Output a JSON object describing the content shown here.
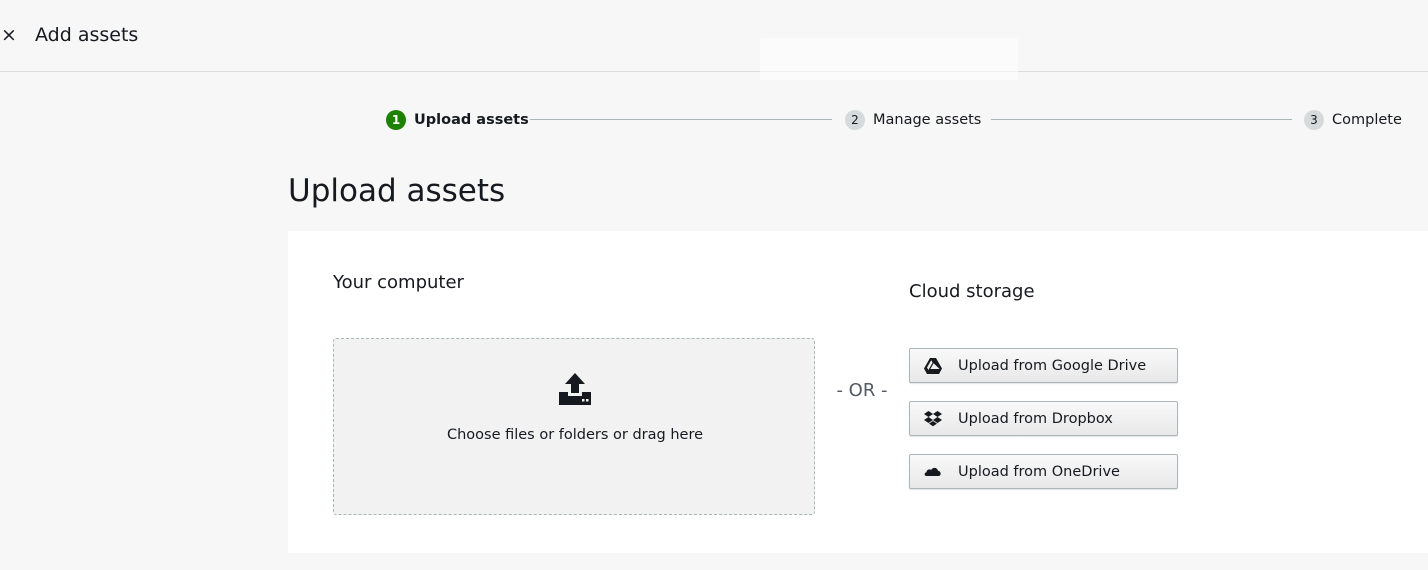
{
  "header": {
    "close_icon": "×",
    "title": "Add assets"
  },
  "stepper": {
    "steps": [
      {
        "number": "1",
        "label": "Upload assets",
        "state": "active"
      },
      {
        "number": "2",
        "label": "Manage assets",
        "state": "upcoming"
      },
      {
        "number": "3",
        "label": "Complete",
        "state": "upcoming"
      }
    ]
  },
  "page": {
    "title": "Upload assets"
  },
  "computer": {
    "heading": "Your computer",
    "dropzone_text": "Choose files or folders or drag here",
    "icon": "upload-icon"
  },
  "divider": {
    "or_text": "- OR -"
  },
  "cloud": {
    "heading": "Cloud storage",
    "buttons": [
      {
        "label": "Upload from Google Drive",
        "icon": "google-drive-icon"
      },
      {
        "label": "Upload from Dropbox",
        "icon": "dropbox-icon"
      },
      {
        "label": "Upload from OneDrive",
        "icon": "onedrive-icon"
      }
    ]
  },
  "colors": {
    "accent": "#1d8102",
    "background": "#f7f7f7",
    "panel": "#ffffff"
  }
}
